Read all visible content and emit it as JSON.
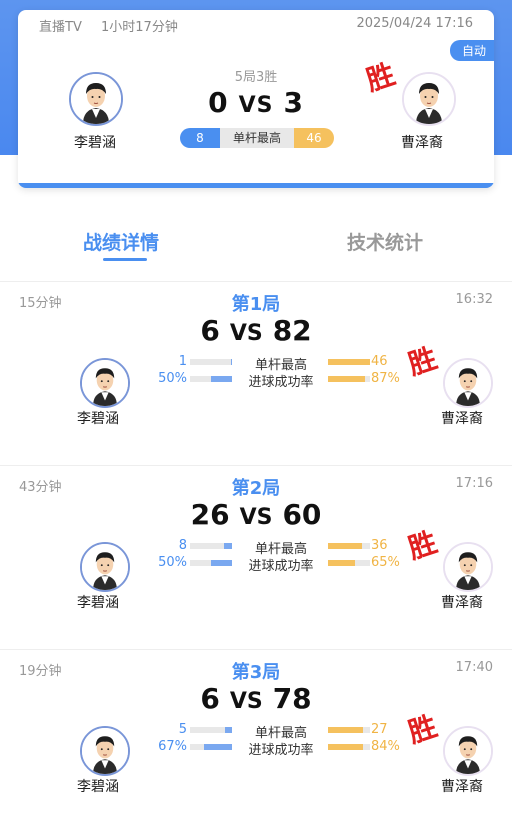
{
  "header": {
    "source": "直播TV",
    "duration": "1小时17分钟",
    "datetime": "2025/04/24 17:16",
    "auto_badge": "自动",
    "format": "5局3胜",
    "score_left": "0",
    "vs": "VS",
    "score_right": "3",
    "stat_label": "单杆最高",
    "stat_left": "8",
    "stat_right": "46",
    "player_left": "李碧涵",
    "player_right": "曹泽裔",
    "win_mark": "胜"
  },
  "tabs": [
    {
      "label": "战绩详情",
      "active": true
    },
    {
      "label": "技术统计",
      "active": false
    }
  ],
  "stat_labels": {
    "high_break": "单杆最高",
    "pot_rate": "进球成功率"
  },
  "games": [
    {
      "duration": "15分钟",
      "title": "第1局",
      "time": "16:32",
      "score_left": "6",
      "vs": "VS",
      "score_right": "82",
      "high_break_left": "1",
      "high_break_right": "46",
      "high_break_left_frac": 0.02,
      "high_break_right_frac": 1.0,
      "pot_left": "50%",
      "pot_right": "87%",
      "pot_left_frac": 0.5,
      "pot_right_frac": 0.87,
      "player_left": "李碧涵",
      "player_right": "曹泽裔",
      "win_mark": "胜"
    },
    {
      "duration": "43分钟",
      "title": "第2局",
      "time": "17:16",
      "score_left": "26",
      "vs": "VS",
      "score_right": "60",
      "high_break_left": "8",
      "high_break_right": "36",
      "high_break_left_frac": 0.18,
      "high_break_right_frac": 0.82,
      "pot_left": "50%",
      "pot_right": "65%",
      "pot_left_frac": 0.5,
      "pot_right_frac": 0.65,
      "player_left": "李碧涵",
      "player_right": "曹泽裔",
      "win_mark": "胜"
    },
    {
      "duration": "19分钟",
      "title": "第3局",
      "time": "17:40",
      "score_left": "6",
      "vs": "VS",
      "score_right": "78",
      "high_break_left": "5",
      "high_break_right": "27",
      "high_break_left_frac": 0.16,
      "high_break_right_frac": 0.84,
      "pot_left": "67%",
      "pot_right": "84%",
      "pot_left_frac": 0.67,
      "pot_right_frac": 0.84,
      "player_left": "李碧涵",
      "player_right": "曹泽裔",
      "win_mark": "胜"
    }
  ],
  "colors": {
    "accent": "#4a8ff0",
    "gold": "#f5c15e",
    "win": "#e02020"
  }
}
